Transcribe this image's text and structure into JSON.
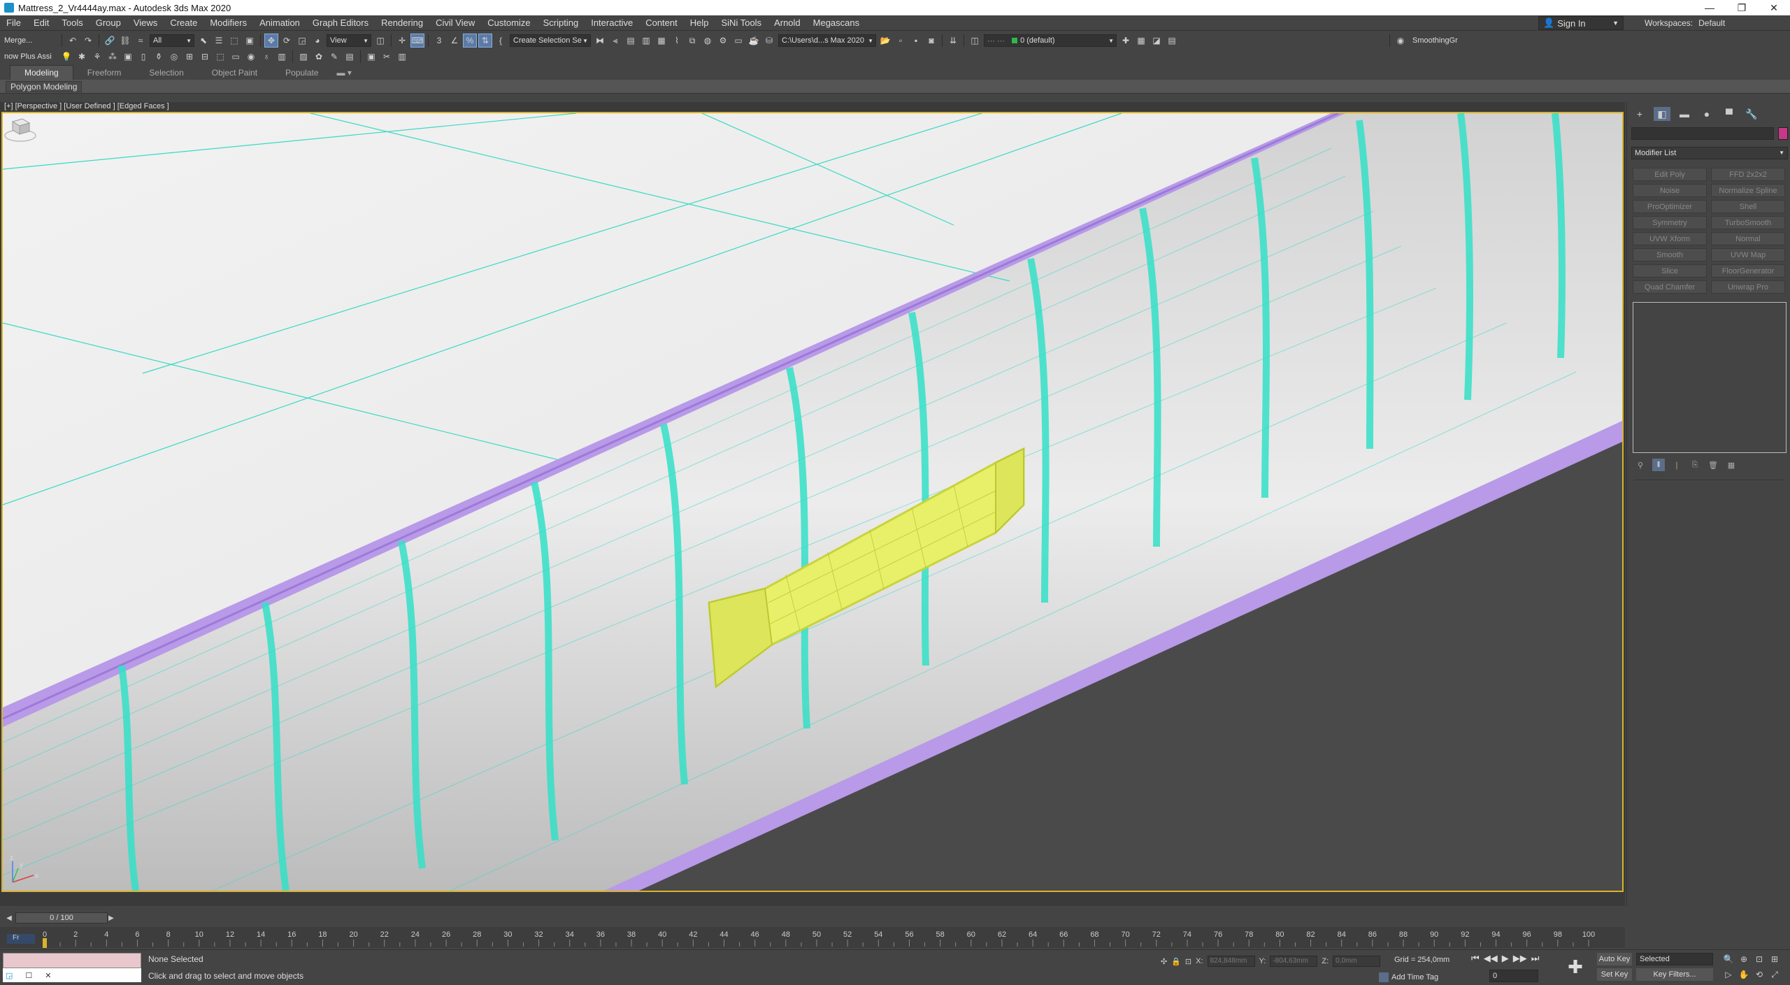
{
  "window": {
    "title": "Mattress_2_Vr4444ay.max - Autodesk 3ds Max 2020",
    "controls": [
      "—",
      "❐",
      "✕"
    ]
  },
  "menu": {
    "items": [
      "File",
      "Edit",
      "Tools",
      "Group",
      "Views",
      "Create",
      "Modifiers",
      "Animation",
      "Graph Editors",
      "Rendering",
      "Civil View",
      "Customize",
      "Scripting",
      "Interactive",
      "Content",
      "Help",
      "SiNi Tools",
      "Arnold",
      "Megascans"
    ],
    "sign_in": "Sign In",
    "workspace_label": "Workspaces:",
    "workspace_value": "Default"
  },
  "toolbar1": {
    "merge": "Merge...",
    "filter": "All",
    "ref_coord": "View",
    "selection_set": "Create Selection Se",
    "path": "C:\\Users\\d...s Max 2020",
    "layer": "0 (default)",
    "smoothing": "SmoothingGr"
  },
  "toolbar2": {
    "label": "now Plus Assi"
  },
  "ribbon": {
    "tabs": [
      "Modeling",
      "Freeform",
      "Selection",
      "Object Paint",
      "Populate"
    ],
    "panel_label": "Polygon Modeling"
  },
  "viewport": {
    "label": "[+] [Perspective ] [User Defined ] [Edged Faces ]",
    "axis_labels": [
      "x",
      "y",
      "z"
    ]
  },
  "command_panel": {
    "tabs": [
      "+",
      "◧",
      "▬",
      "●",
      "▀",
      "🔧"
    ],
    "modifier_list": "Modifier List",
    "modifiers": [
      "Edit Poly",
      "FFD 2x2x2",
      "Noise",
      "Normalize Spline",
      "ProOptimizer",
      "Shell",
      "Symmetry",
      "TurboSmooth",
      "UVW Xform",
      "Normal",
      "Smooth",
      "UVW Map",
      "Slice",
      "FloorGenerator",
      "Quad Chamfer",
      "Unwrap Pro"
    ],
    "stack_tools": [
      "⚲",
      "‖",
      "∣",
      "⎘",
      "🗑",
      "▦"
    ]
  },
  "timeline": {
    "position": "0 / 100",
    "ticks": [
      "0",
      "2",
      "4",
      "6",
      "8",
      "10",
      "12",
      "14",
      "16",
      "18",
      "20",
      "22",
      "24",
      "26",
      "28",
      "30",
      "32",
      "34",
      "36",
      "38",
      "40",
      "42",
      "44",
      "46",
      "48",
      "50",
      "52",
      "54",
      "56",
      "58",
      "60",
      "62",
      "64",
      "66",
      "68",
      "70",
      "72",
      "74",
      "76",
      "78",
      "80",
      "82",
      "84",
      "86",
      "88",
      "90",
      "92",
      "94",
      "96",
      "98",
      "100"
    ],
    "start_label": "Fr"
  },
  "status": {
    "selection": "None Selected",
    "prompt": "Click and drag to select and move objects",
    "x_label": "X:",
    "x_value": "824,848mm",
    "y_label": "Y:",
    "y_value": "-804,63mm",
    "z_label": "Z:",
    "z_value": "0,0mm",
    "grid": "Grid = 254,0mm",
    "add_time_tag": "Add Time Tag",
    "frame": "0",
    "auto_key": "Auto Key",
    "set_key": "Set Key",
    "selected": "Selected",
    "key_filters": "Key Filters..."
  }
}
